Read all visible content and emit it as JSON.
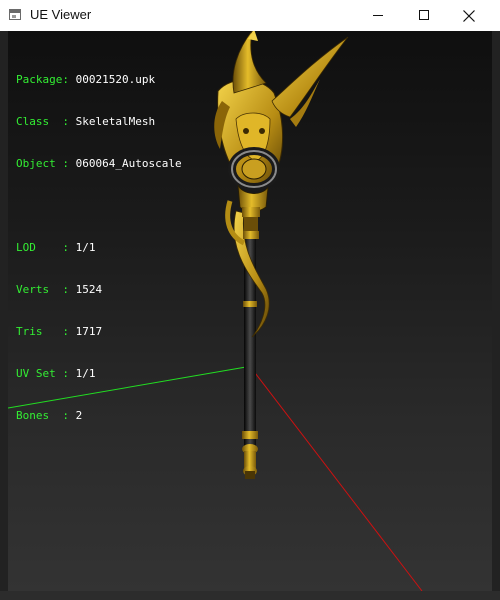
{
  "window": {
    "title": "UE Viewer"
  },
  "info": {
    "rows": [
      {
        "key": "Package:",
        "value": "00021520.upk"
      },
      {
        "key": "Class  :",
        "value": "SkeletalMesh"
      },
      {
        "key": "Object :",
        "value": "060064_Autoscale"
      }
    ],
    "stats": [
      {
        "key": "LOD    :",
        "value": "1/1"
      },
      {
        "key": "Verts  :",
        "value": "1524"
      },
      {
        "key": "Tris   :",
        "value": "1717"
      },
      {
        "key": "UV Set :",
        "value": "1/1"
      },
      {
        "key": "Bones  :",
        "value": "2"
      }
    ]
  },
  "colors": {
    "key_text": "#33ee33",
    "value_text": "#ffffff",
    "axis_x": "#cc1111",
    "axis_y": "#22dd22",
    "mesh_gold": "#d4a81c"
  },
  "icons": {
    "app": "window-icon",
    "minimize": "minimize-icon",
    "maximize": "maximize-icon",
    "close": "close-icon"
  }
}
